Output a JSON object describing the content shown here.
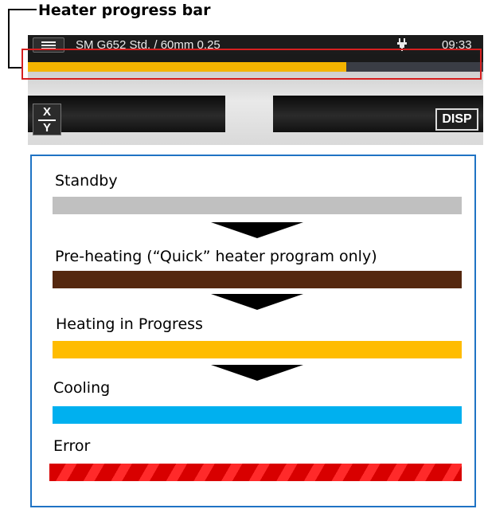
{
  "callout": {
    "title": "Heater progress bar",
    "highlight_color": "#d62020"
  },
  "device": {
    "menu_icon": "hamburger-icon",
    "title": "SM G652 Std. / 60mm 0.25",
    "power_icon": "plug-icon",
    "time": "09:33",
    "heater_progress": 0.7,
    "heater_fill_color": "#f4b400",
    "xy_button": {
      "top": "X",
      "bottom": "Y"
    },
    "disp_button": "DISP"
  },
  "legend": {
    "border_color": "#1f73c4",
    "states": [
      {
        "label": "Standby",
        "color": "#c0c0c0"
      },
      {
        "label": "Pre-heating (“Quick” heater program only)",
        "color": "#55280f"
      },
      {
        "label": "Heating in Progress",
        "color": "#ffbc00"
      },
      {
        "label": "Cooling",
        "color": "#00b0ef"
      },
      {
        "label": "Error",
        "color": "#d80000",
        "pattern": "striped"
      }
    ]
  }
}
